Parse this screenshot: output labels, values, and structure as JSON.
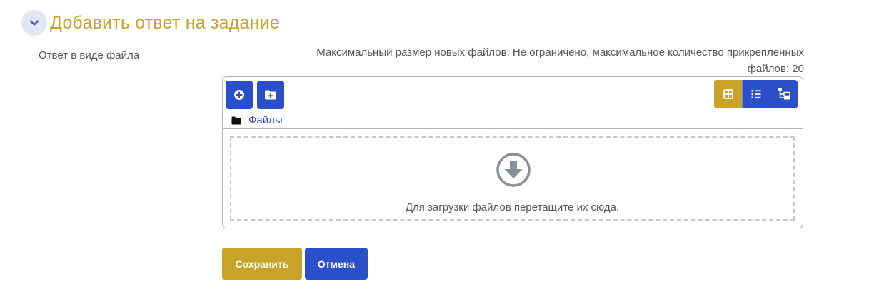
{
  "section": {
    "title": "Добавить ответ на задание"
  },
  "field": {
    "label": "Ответ в виде файла"
  },
  "limits": {
    "text_line1": "Максимальный размер новых файлов: Не ограничено, максимальное количество прикрепленных",
    "text_line2": "файлов: 20"
  },
  "filemanager": {
    "add_icon": "add-file-icon",
    "mkdir_icon": "create-folder-icon",
    "views": [
      "grid-view-icon",
      "list-view-icon",
      "tree-view-icon"
    ],
    "active_view": "grid-view-icon",
    "path_label": "Файлы",
    "dropzone_text": "Для загрузки файлов перетащите их сюда."
  },
  "buttons": {
    "save_label": "Сохранить",
    "cancel_label": "Отмена"
  },
  "colors": {
    "accent_gold": "#c9a228",
    "primary_blue": "#2a4fc9"
  }
}
